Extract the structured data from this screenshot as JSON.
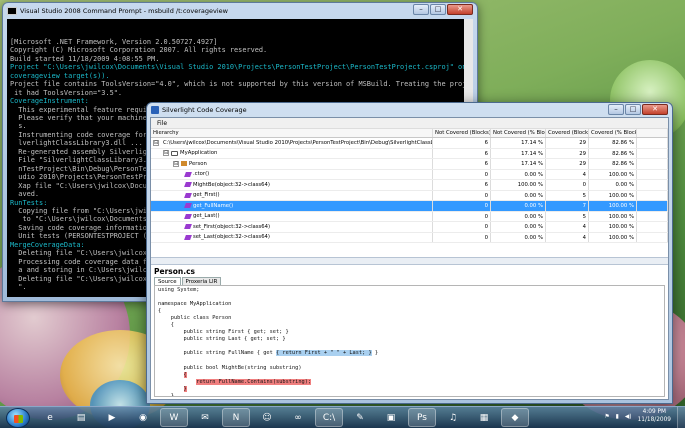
{
  "cmd": {
    "title": "Visual Studio 2008 Command Prompt - msbuild  /t:coverageview",
    "lines": [
      {
        "t": "[Microsoft .NET Framework, Version 2.0.50727.4927]",
        "c": ""
      },
      {
        "t": "Copyright (C) Microsoft Corporation 2007. All rights reserved.",
        "c": ""
      },
      {
        "t": "",
        "c": ""
      },
      {
        "t": "Build started 11/18/2009 4:08:55 PM.",
        "c": ""
      },
      {
        "t": "Project \"C:\\Users\\jwilcox\\Documents\\Visual Studio 2010\\Projects\\PersonTestProject\\PersonTestProject.csproj\" on node 0 (",
        "c": "c"
      },
      {
        "t": "coverageview target(s)).",
        "c": "c"
      },
      {
        "t": "Project file contains ToolsVersion=\"4.0\", which is not supported by this version of MSBuild. Treating the project as if",
        "c": ""
      },
      {
        "t": " it had ToolsVersion=\"3.5\".",
        "c": ""
      },
      {
        "t": "CoverageInstrument:",
        "c": "c"
      },
      {
        "t": "  This experimental feature require",
        "c": ""
      },
      {
        "t": "  Please verify that your machine h",
        "c": ""
      },
      {
        "t": "  s.",
        "c": ""
      },
      {
        "t": "  Instrumenting code coverage for E",
        "c": ""
      },
      {
        "t": "  lverlightClassLibrary3.dll ...",
        "c": ""
      },
      {
        "t": "  Re-generated assembly Silverlight",
        "c": ""
      },
      {
        "t": "  File \"SilverlightClassLibrary3.dl",
        "c": ""
      },
      {
        "t": "  nTestProject\\Bin\\Debug\\PersonTest",
        "c": ""
      },
      {
        "t": "  udio 2010\\Projects\\PersonTestProj",
        "c": ""
      },
      {
        "t": "  Xap file \"C:\\Users\\jwilcox\\Docum",
        "c": ""
      },
      {
        "t": "  aved.",
        "c": ""
      },
      {
        "t": "RunTests:",
        "c": "c"
      },
      {
        "t": "  Copying file from \"C:\\Users\\jwilco",
        "c": ""
      },
      {
        "t": "   to \"C:\\Users\\jwilcox\\Documents\\V",
        "c": ""
      },
      {
        "t": "  Saving code coverage information...",
        "c": ""
      },
      {
        "t": "  Unit tests (PERSONTESTPROJECT (Al",
        "c": ""
      },
      {
        "t": "MergeCoverageData:",
        "c": "c"
      },
      {
        "t": "  Deleting file \"C:\\Users\\jwilcox\\",
        "c": ""
      },
      {
        "t": "  Processing code coverage data from",
        "c": ""
      },
      {
        "t": "  a and storing in C:\\Users\\jwilcox\\",
        "c": ""
      },
      {
        "t": "  Deleting file \"C:\\Users\\jwilcox\\",
        "c": ""
      },
      {
        "t": "  \".",
        "c": ""
      }
    ]
  },
  "coverage": {
    "title": "Silverlight Code Coverage",
    "menu": "File",
    "columns": [
      "Hierarchy",
      "Not Covered (Blocks)",
      "Not Covered (% Blocks)",
      "Covered (Blocks)",
      "Covered (% Blocks)"
    ],
    "rows": [
      {
        "name": "C:\\Users\\jwilcox\\Documents\\Visual Studio 2010\\Projects\\PersonTestProject\\Bin\\Debug\\SilverlightClassLibrary3.dll",
        "exp": "⊟",
        "kind": "asm",
        "nc": "6",
        "ncp": "17.14 %",
        "cv": "29",
        "cvp": "82.86 %"
      },
      {
        "name": "MyApplication",
        "exp": "⊟",
        "kind": "ns",
        "nc": "6",
        "ncp": "17.14 %",
        "cv": "29",
        "cvp": "82.86 %"
      },
      {
        "name": "Person",
        "exp": "⊟",
        "kind": "cls",
        "nc": "6",
        "ncp": "17.14 %",
        "cv": "29",
        "cvp": "82.86 %"
      },
      {
        "name": ".ctor()",
        "exp": "",
        "kind": "mth",
        "nc": "0",
        "ncp": "0.00 %",
        "cv": "4",
        "cvp": "100.00 %"
      },
      {
        "name": "MightBe(object:32->class64)",
        "exp": "",
        "kind": "mth",
        "nc": "6",
        "ncp": "100.00 %",
        "cv": "0",
        "cvp": "0.00 %"
      },
      {
        "name": "get_First()",
        "exp": "",
        "kind": "mth",
        "nc": "0",
        "ncp": "0.00 %",
        "cv": "5",
        "cvp": "100.00 %"
      },
      {
        "name": "get_FullName()",
        "exp": "",
        "kind": "mth",
        "nc": "0",
        "ncp": "0.00 %",
        "cv": "7",
        "cvp": "100.00 %"
      },
      {
        "name": "get_Last()",
        "exp": "",
        "kind": "mth",
        "nc": "0",
        "ncp": "0.00 %",
        "cv": "5",
        "cvp": "100.00 %"
      },
      {
        "name": "set_First(object:32->class64)",
        "exp": "",
        "kind": "mth",
        "nc": "0",
        "ncp": "0.00 %",
        "cv": "4",
        "cvp": "100.00 %"
      },
      {
        "name": "set_Last(object:32->class64)",
        "exp": "",
        "kind": "mth",
        "nc": "0",
        "ncp": "0.00 %",
        "cv": "4",
        "cvp": "100.00 %"
      }
    ],
    "selected_row": 6,
    "file_title": "Person.cs",
    "tabs": [
      "Source",
      "Proxeria LIR"
    ],
    "code": {
      "l1": "using System;",
      "l2": "",
      "l3": "namespace MyApplication",
      "l4": "{",
      "l5": "    public class Person",
      "l6": "    {",
      "l7": "        public string First { get; set; }",
      "l8": "        public string Last { get; set; }",
      "l9": "",
      "l10a": "        public string FullName { get ",
      "l10b": "{ return First + \" \" + Last; }",
      "l10c": " }",
      "l11": "",
      "l12": "        public bool MightBe(string substring)",
      "l13a": "        ",
      "l13b": "{",
      "l14a": "            ",
      "l14b": "return FullName.Contains(substring);",
      "l15a": "        ",
      "l15b": "}",
      "l16": "    }",
      "l17": "}"
    }
  },
  "taskbar": {
    "time": "4:09 PM",
    "date": "11/18/2009",
    "apps": [
      {
        "name": "ie-icon",
        "glyph": "e",
        "open": false
      },
      {
        "name": "explorer-icon",
        "glyph": "▤",
        "open": false
      },
      {
        "name": "media-player-icon",
        "glyph": "▶",
        "open": false
      },
      {
        "name": "chrome-icon",
        "glyph": "◉",
        "open": false
      },
      {
        "name": "word-icon",
        "glyph": "W",
        "open": true
      },
      {
        "name": "outlook-icon",
        "glyph": "✉",
        "open": false
      },
      {
        "name": "onenote-icon",
        "glyph": "N",
        "open": true
      },
      {
        "name": "messenger-icon",
        "glyph": "☺",
        "open": false
      },
      {
        "name": "visual-studio-icon",
        "glyph": "∞",
        "open": false
      },
      {
        "name": "command-prompt-icon",
        "glyph": "C:\\",
        "open": true
      },
      {
        "name": "pen-icon",
        "glyph": "✎",
        "open": false
      },
      {
        "name": "terminal-icon",
        "glyph": "▣",
        "open": false
      },
      {
        "name": "photoshop-icon",
        "glyph": "Ps",
        "open": true
      },
      {
        "name": "media-icon",
        "glyph": "♫",
        "open": false
      },
      {
        "name": "notepad-icon",
        "glyph": "▦",
        "open": false
      },
      {
        "name": "silverlight-icon",
        "glyph": "◆",
        "open": true
      }
    ]
  }
}
